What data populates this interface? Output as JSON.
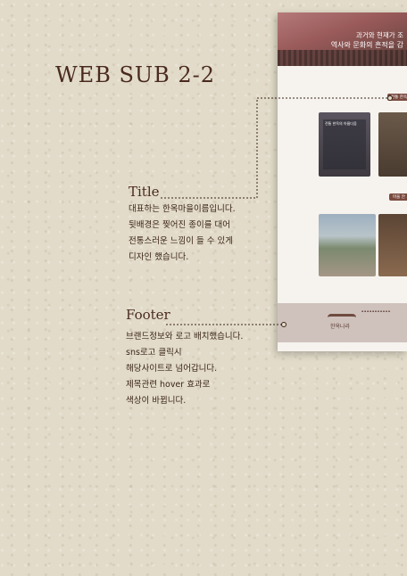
{
  "page": {
    "title": "WEB SUB 2-2"
  },
  "annotations": {
    "title": {
      "label": "Title",
      "lines": [
        "대표하는 한옥마을이름입니다.",
        "뒷배경은 찢어진 종이를 대어",
        "전통스러운 느낌이 들 수 있게",
        "디자인 했습니다."
      ]
    },
    "footer": {
      "label": "Footer",
      "lines": [
        "브랜드정보와 로고 배치했습니다.",
        "sns로고 클릭시",
        "해당사이트로 넘어갑니다.",
        "제목관련 hover 효과로",
        "색상이 바뀝니다."
      ]
    }
  },
  "preview": {
    "hero_line1": "과거와 현재가 조",
    "hero_line2": "역사와 문화의 흔적을 감",
    "tag1": "전통 한옥",
    "tag2": "마을 안",
    "card1_title": "전통 한옥의 아름다움",
    "footer_brand": "한옥나라"
  },
  "colors": {
    "background": "#e2dbc9",
    "text": "#4a2a1f",
    "accent": "#7a4a3f"
  }
}
